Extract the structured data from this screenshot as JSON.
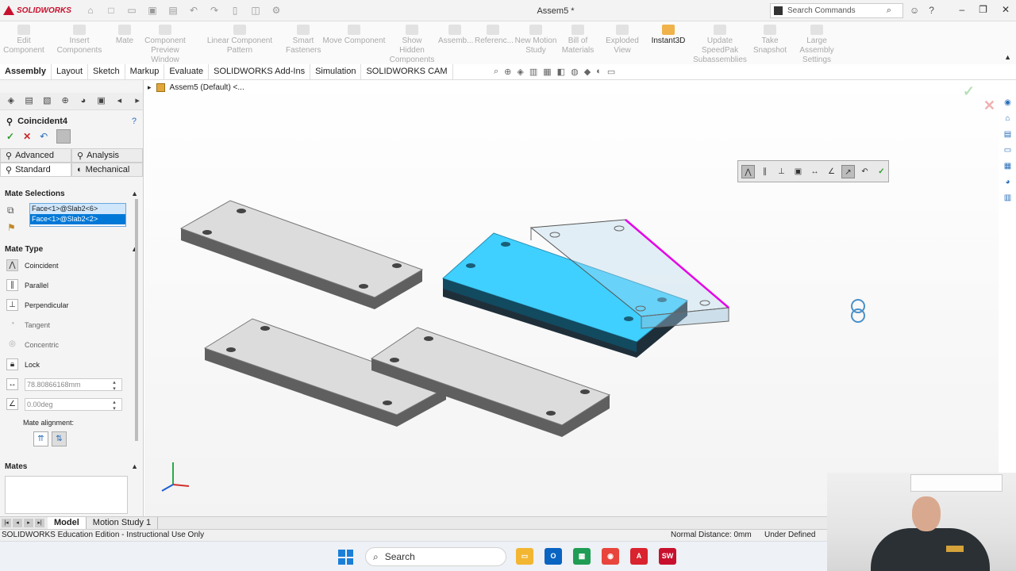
{
  "titlebar": {
    "brand": "SOLIDWORKS",
    "doc_title": "Assem5 *",
    "search_placeholder": "Search Commands"
  },
  "command_manager": [
    {
      "label1": "Edit",
      "label2": "Component",
      "active": false
    },
    {
      "label1": "Insert Components",
      "label2": "",
      "active": false
    },
    {
      "label1": "Mate",
      "label2": "",
      "active": false
    },
    {
      "label1": "Component",
      "label2": "Preview Window",
      "active": false
    },
    {
      "label1": "Linear Component Pattern",
      "label2": "",
      "active": false
    },
    {
      "label1": "Smart",
      "label2": "Fasteners",
      "active": false
    },
    {
      "label1": "Move Component",
      "label2": "",
      "active": false
    },
    {
      "label1": "Show Hidden",
      "label2": "Components",
      "active": false
    },
    {
      "label1": "Assemb...",
      "label2": "",
      "active": false
    },
    {
      "label1": "Referenc...",
      "label2": "",
      "active": false
    },
    {
      "label1": "New Motion",
      "label2": "Study",
      "active": false
    },
    {
      "label1": "Bill of",
      "label2": "Materials",
      "active": false
    },
    {
      "label1": "Exploded View",
      "label2": "",
      "active": false
    },
    {
      "label1": "Instant3D",
      "label2": "",
      "active": true
    },
    {
      "label1": "Update SpeedPak",
      "label2": "Subassemblies",
      "active": false
    },
    {
      "label1": "Take",
      "label2": "Snapshot",
      "active": false
    },
    {
      "label1": "Large Assembly",
      "label2": "Settings",
      "active": false
    }
  ],
  "tabs": [
    "Assembly",
    "Layout",
    "Sketch",
    "Markup",
    "Evaluate",
    "SOLIDWORKS Add-Ins",
    "Simulation",
    "SOLIDWORKS CAM"
  ],
  "property_manager": {
    "title": "Coincident4",
    "subtabs": {
      "advanced": "Advanced",
      "analysis": "Analysis",
      "standard": "Standard",
      "mechanical": "Mechanical"
    },
    "mate_selections": {
      "header": "Mate Selections",
      "items": [
        "Face<1>@Slab2<6>",
        "Face<1>@Slab2<2>"
      ]
    },
    "mate_type": {
      "header": "Mate Type",
      "items": [
        "Coincident",
        "Parallel",
        "Perpendicular",
        "Tangent",
        "Concentric",
        "Lock"
      ]
    },
    "distance_value": "78.80866168mm",
    "angle_value": "0.00deg",
    "alignment_label": "Mate alignment:",
    "mates_header": "Mates"
  },
  "graphics": {
    "tree_label": "Assem5 (Default) <..."
  },
  "bottom_tabs": [
    "Model",
    "Motion Study 1"
  ],
  "status": {
    "left": "SOLIDWORKS Education Edition - Instructional Use Only",
    "distance": "Normal Distance: 0mm",
    "definition": "Under Defined"
  },
  "taskbar": {
    "search_label": "Search"
  },
  "colors": {
    "selected_face": "#3fd0ff",
    "highlight_edge": "#e600e6",
    "brand_red": "#c8102e"
  }
}
